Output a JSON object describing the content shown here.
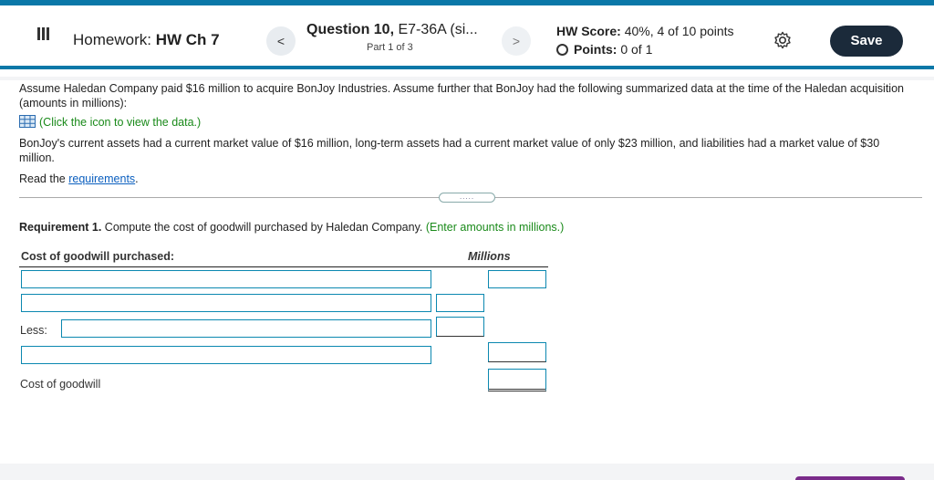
{
  "header": {
    "homework_prefix": "Homework:",
    "homework_name": "HW Ch 7",
    "prev_label": "<",
    "next_label": ">",
    "question_title": "Question 10,",
    "question_code": "E7-36A (si...",
    "part": "Part 1 of 3",
    "score_label": "HW Score:",
    "score_value": "40%, 4 of 10 points",
    "points_label": "Points:",
    "points_value": "0 of 1",
    "save_label": "Save"
  },
  "question": {
    "para1": "Assume Haledan Company paid $16 million to acquire BonJoy Industries. Assume further that BonJoy had the following summarized data at the time of the Haledan acquisition (amounts in millions):",
    "data_link": "(Click the icon to view the data.)",
    "para2": "BonJoy's current assets had a current market value of $16 million, long-term assets had a current market value of only $23 million, and liabilities had a market value of $30 million.",
    "read_prefix": "Read the",
    "requirements_link": "requirements",
    "read_suffix": "."
  },
  "divider": {
    "handle": "....."
  },
  "requirement": {
    "title": "Requirement 1.",
    "text": "Compute the cost of goodwill purchased by Haledan Company.",
    "hint": "(Enter amounts in millions.)"
  },
  "table": {
    "header_label": "Cost of goodwill purchased:",
    "column_label": "Millions",
    "less_label": "Less:",
    "total_label": "Cost of goodwill"
  },
  "colors": {
    "accent": "#0b78a8",
    "hint_green": "#1a8a1a",
    "link_blue": "#0b5fbf",
    "save_bg": "#1b2a3a"
  }
}
